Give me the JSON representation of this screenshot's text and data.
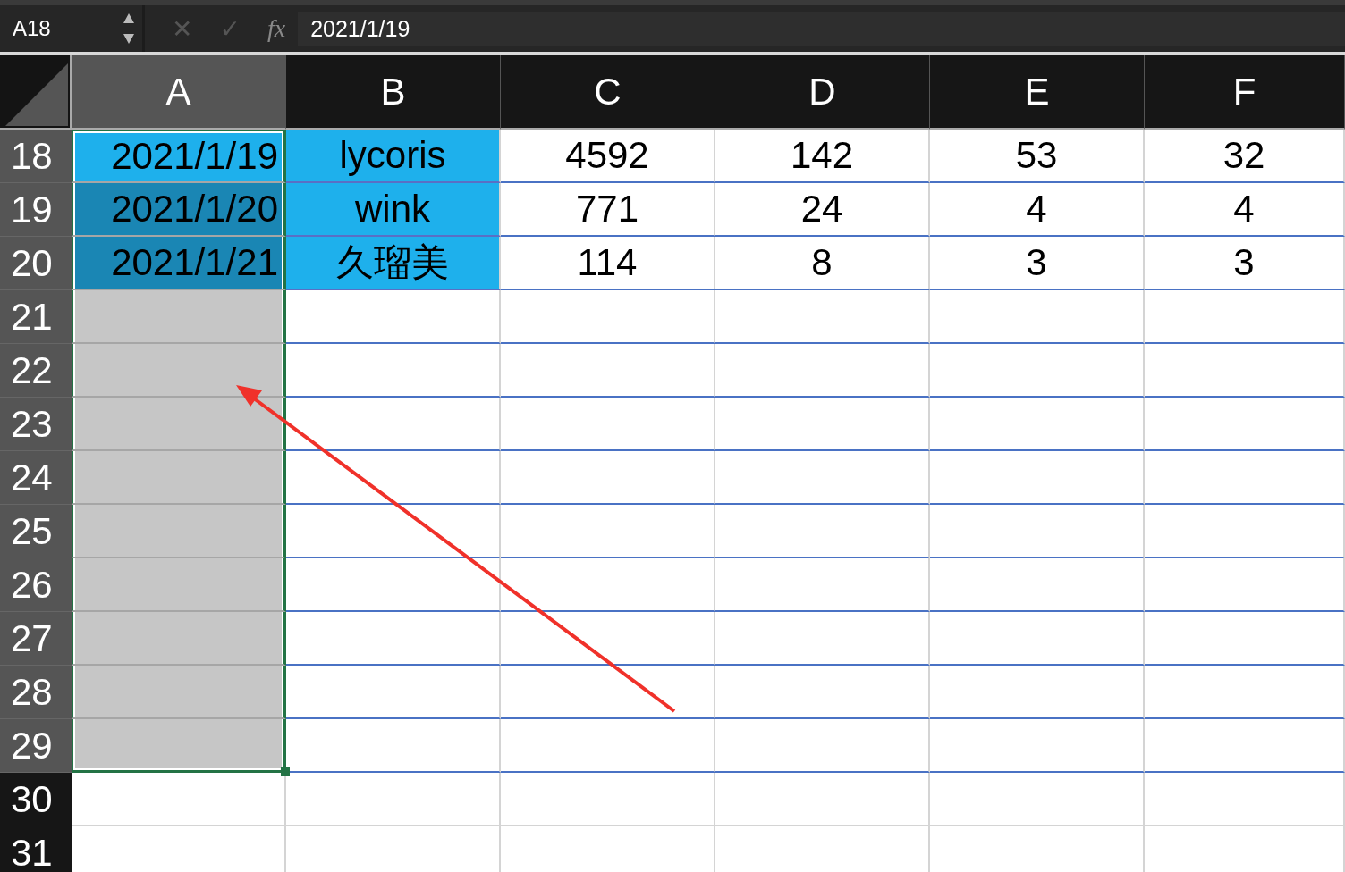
{
  "formula_bar": {
    "name_box": "A18",
    "cancel": "✕",
    "confirm": "✓",
    "fx": "fx",
    "value": "2021/1/19"
  },
  "columns": [
    {
      "label": "A",
      "selected": true
    },
    {
      "label": "B",
      "selected": false
    },
    {
      "label": "C",
      "selected": false
    },
    {
      "label": "D",
      "selected": false
    },
    {
      "label": "E",
      "selected": false
    },
    {
      "label": "F",
      "selected": false
    }
  ],
  "rows": [
    {
      "number": "18",
      "selected": true,
      "bordered": true,
      "cells": [
        {
          "text": "2021/1/19",
          "filled": true,
          "selected": true,
          "active": true
        },
        {
          "text": "lycoris",
          "filled": true,
          "selected": false,
          "active": false
        },
        {
          "text": "4592",
          "filled": false,
          "selected": false,
          "active": false
        },
        {
          "text": "142",
          "filled": false,
          "selected": false,
          "active": false
        },
        {
          "text": "53",
          "filled": false,
          "selected": false,
          "active": false
        },
        {
          "text": "32",
          "filled": false,
          "selected": false,
          "active": false
        }
      ]
    },
    {
      "number": "19",
      "selected": true,
      "bordered": true,
      "cells": [
        {
          "text": "2021/1/20",
          "filled": true,
          "selected": true,
          "active": false
        },
        {
          "text": "wink",
          "filled": true,
          "selected": false,
          "active": false
        },
        {
          "text": "771",
          "filled": false,
          "selected": false,
          "active": false
        },
        {
          "text": "24",
          "filled": false,
          "selected": false,
          "active": false
        },
        {
          "text": "4",
          "filled": false,
          "selected": false,
          "active": false
        },
        {
          "text": "4",
          "filled": false,
          "selected": false,
          "active": false
        }
      ]
    },
    {
      "number": "20",
      "selected": true,
      "bordered": true,
      "cells": [
        {
          "text": "2021/1/21",
          "filled": true,
          "selected": true,
          "active": false
        },
        {
          "text": "久瑠美",
          "filled": true,
          "selected": false,
          "active": false
        },
        {
          "text": "114",
          "filled": false,
          "selected": false,
          "active": false
        },
        {
          "text": "8",
          "filled": false,
          "selected": false,
          "active": false
        },
        {
          "text": "3",
          "filled": false,
          "selected": false,
          "active": false
        },
        {
          "text": "3",
          "filled": false,
          "selected": false,
          "active": false
        }
      ]
    },
    {
      "number": "21",
      "selected": true,
      "bordered": true,
      "cells": [
        {
          "filled": false,
          "selected": true,
          "active": false
        },
        {
          "filled": false,
          "selected": false,
          "active": false
        },
        {
          "filled": false,
          "selected": false,
          "active": false
        },
        {
          "filled": false,
          "selected": false,
          "active": false
        },
        {
          "filled": false,
          "selected": false,
          "active": false
        },
        {
          "filled": false,
          "selected": false,
          "active": false
        }
      ]
    },
    {
      "number": "22",
      "selected": true,
      "bordered": true,
      "cells": [
        {
          "filled": false,
          "selected": true,
          "active": false
        },
        {
          "filled": false,
          "selected": false,
          "active": false
        },
        {
          "filled": false,
          "selected": false,
          "active": false
        },
        {
          "filled": false,
          "selected": false,
          "active": false
        },
        {
          "filled": false,
          "selected": false,
          "active": false
        },
        {
          "filled": false,
          "selected": false,
          "active": false
        }
      ]
    },
    {
      "number": "23",
      "selected": true,
      "bordered": true,
      "cells": [
        {
          "filled": false,
          "selected": true,
          "active": false
        },
        {
          "filled": false,
          "selected": false,
          "active": false
        },
        {
          "filled": false,
          "selected": false,
          "active": false
        },
        {
          "filled": false,
          "selected": false,
          "active": false
        },
        {
          "filled": false,
          "selected": false,
          "active": false
        },
        {
          "filled": false,
          "selected": false,
          "active": false
        }
      ]
    },
    {
      "number": "24",
      "selected": true,
      "bordered": true,
      "cells": [
        {
          "filled": false,
          "selected": true,
          "active": false
        },
        {
          "filled": false,
          "selected": false,
          "active": false
        },
        {
          "filled": false,
          "selected": false,
          "active": false
        },
        {
          "filled": false,
          "selected": false,
          "active": false
        },
        {
          "filled": false,
          "selected": false,
          "active": false
        },
        {
          "filled": false,
          "selected": false,
          "active": false
        }
      ]
    },
    {
      "number": "25",
      "selected": true,
      "bordered": true,
      "cells": [
        {
          "filled": false,
          "selected": true,
          "active": false
        },
        {
          "filled": false,
          "selected": false,
          "active": false
        },
        {
          "filled": false,
          "selected": false,
          "active": false
        },
        {
          "filled": false,
          "selected": false,
          "active": false
        },
        {
          "filled": false,
          "selected": false,
          "active": false
        },
        {
          "filled": false,
          "selected": false,
          "active": false
        }
      ]
    },
    {
      "number": "26",
      "selected": true,
      "bordered": true,
      "cells": [
        {
          "filled": false,
          "selected": true,
          "active": false
        },
        {
          "filled": false,
          "selected": false,
          "active": false
        },
        {
          "filled": false,
          "selected": false,
          "active": false
        },
        {
          "filled": false,
          "selected": false,
          "active": false
        },
        {
          "filled": false,
          "selected": false,
          "active": false
        },
        {
          "filled": false,
          "selected": false,
          "active": false
        }
      ]
    },
    {
      "number": "27",
      "selected": true,
      "bordered": true,
      "cells": [
        {
          "filled": false,
          "selected": true,
          "active": false
        },
        {
          "filled": false,
          "selected": false,
          "active": false
        },
        {
          "filled": false,
          "selected": false,
          "active": false
        },
        {
          "filled": false,
          "selected": false,
          "active": false
        },
        {
          "filled": false,
          "selected": false,
          "active": false
        },
        {
          "filled": false,
          "selected": false,
          "active": false
        }
      ]
    },
    {
      "number": "28",
      "selected": true,
      "bordered": true,
      "cells": [
        {
          "filled": false,
          "selected": true,
          "active": false
        },
        {
          "filled": false,
          "selected": false,
          "active": false
        },
        {
          "filled": false,
          "selected": false,
          "active": false
        },
        {
          "filled": false,
          "selected": false,
          "active": false
        },
        {
          "filled": false,
          "selected": false,
          "active": false
        },
        {
          "filled": false,
          "selected": false,
          "active": false
        }
      ]
    },
    {
      "number": "29",
      "selected": true,
      "bordered": true,
      "cells": [
        {
          "filled": false,
          "selected": true,
          "active": false
        },
        {
          "filled": false,
          "selected": false,
          "active": false
        },
        {
          "filled": false,
          "selected": false,
          "active": false
        },
        {
          "filled": false,
          "selected": false,
          "active": false
        },
        {
          "filled": false,
          "selected": false,
          "active": false
        },
        {
          "filled": false,
          "selected": false,
          "active": false
        }
      ]
    },
    {
      "number": "30",
      "selected": false,
      "bordered": false,
      "cells": [
        {
          "filled": false,
          "selected": false,
          "active": false
        },
        {
          "filled": false,
          "selected": false,
          "active": false
        },
        {
          "filled": false,
          "selected": false,
          "active": false
        },
        {
          "filled": false,
          "selected": false,
          "active": false
        },
        {
          "filled": false,
          "selected": false,
          "active": false
        },
        {
          "filled": false,
          "selected": false,
          "active": false
        }
      ]
    },
    {
      "number": "31",
      "selected": false,
      "cells": [
        {
          "filled": false,
          "selected": false,
          "active": false
        },
        {
          "filled": false,
          "selected": false,
          "active": false
        },
        {
          "filled": false,
          "selected": false,
          "active": false
        },
        {
          "filled": false,
          "selected": false,
          "active": false
        },
        {
          "filled": false,
          "selected": false,
          "active": false
        },
        {
          "filled": false,
          "selected": false,
          "active": false
        }
      ]
    }
  ],
  "annotations": [
    {
      "kind": "arrow"
    }
  ]
}
